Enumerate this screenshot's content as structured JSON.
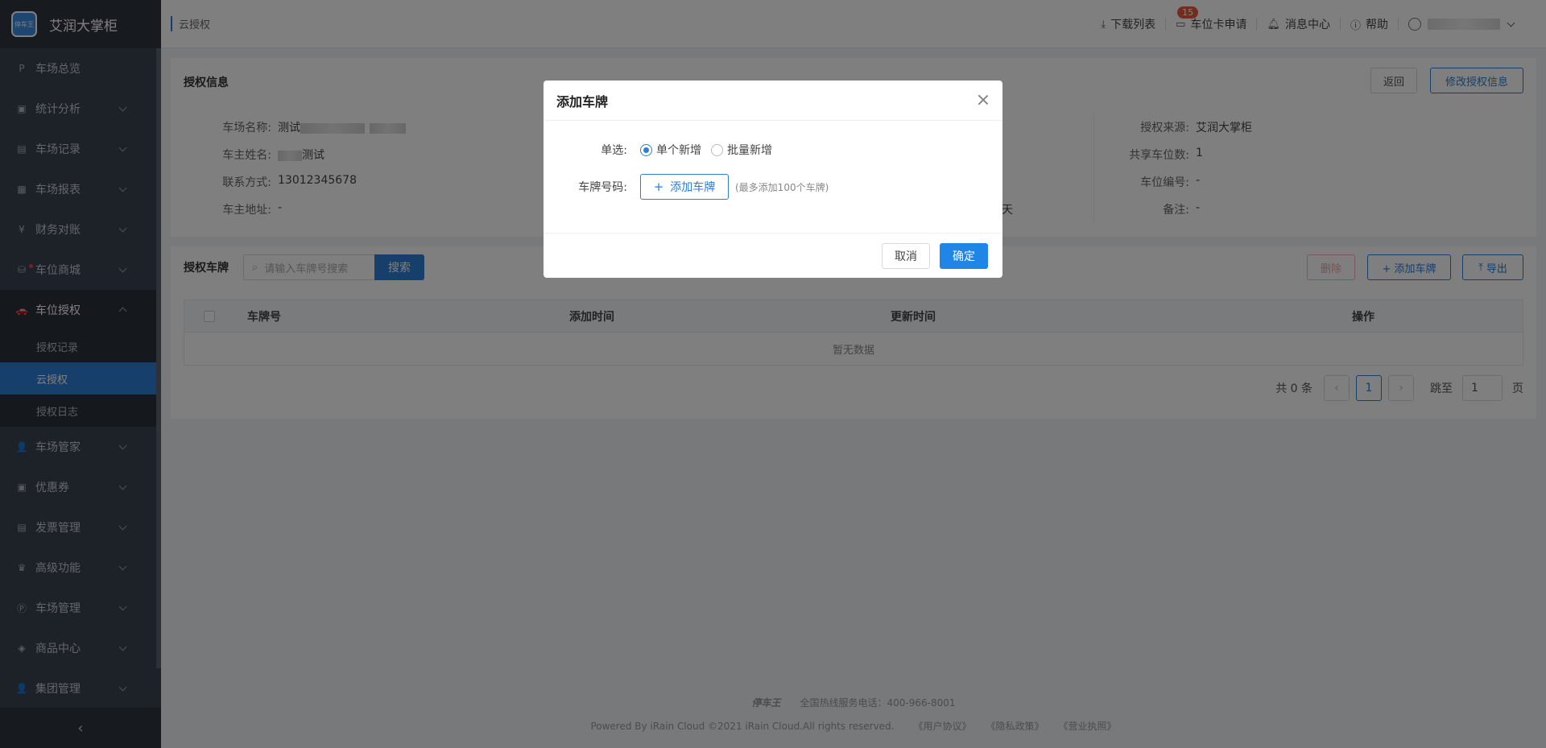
{
  "app": {
    "logo_text": "停车王",
    "name": "艾润大掌柜"
  },
  "sidebar": {
    "items": [
      {
        "label": "车场总览",
        "icon": "P"
      },
      {
        "label": "统计分析",
        "icon": "▣"
      },
      {
        "label": "车场记录",
        "icon": "▤"
      },
      {
        "label": "车场报表",
        "icon": "▦"
      },
      {
        "label": "财务对账",
        "icon": "¥"
      },
      {
        "label": "车位商城",
        "icon": "⛁"
      },
      {
        "label": "车位授权",
        "icon": "🚗"
      }
    ],
    "sub_items": [
      "授权记录",
      "云授权",
      "授权日志"
    ],
    "items_after": [
      {
        "label": "车场管家",
        "icon": "👤"
      },
      {
        "label": "优惠券",
        "icon": "▣"
      },
      {
        "label": "发票管理",
        "icon": "▤"
      },
      {
        "label": "高级功能",
        "icon": "♛"
      },
      {
        "label": "车场管理",
        "icon": "Ⓟ"
      },
      {
        "label": "商品中心",
        "icon": "◈"
      },
      {
        "label": "集团管理",
        "icon": "👤"
      }
    ],
    "collapse": "‹"
  },
  "header": {
    "breadcrumb": "云授权",
    "download": "下载列表",
    "card_apply": "车位卡申请",
    "badge": "15",
    "messages": "消息中心",
    "help": "帮助"
  },
  "info": {
    "title": "授权信息",
    "back": "返回",
    "edit": "修改授权信息",
    "rows": [
      {
        "label": "车场名称:",
        "value": "测试"
      },
      {
        "label": "车主姓名:",
        "value": "测试"
      },
      {
        "label": "联系方式:",
        "value": "13012345678"
      },
      {
        "label": "车主地址:",
        "value": "-"
      }
    ],
    "right_rows": [
      {
        "label": "授权来源:",
        "value": "艾润大掌柜"
      },
      {
        "label": "共享车位数:",
        "value": "1"
      },
      {
        "label": "车位编号:",
        "value": "-"
      },
      {
        "label": "备注:",
        "value": "-"
      }
    ],
    "partial_text": "天"
  },
  "list": {
    "title": "授权车牌",
    "search_placeholder": "请输入车牌号搜索",
    "search_btn": "搜索",
    "delete": "删除",
    "add": "+ 添加车牌",
    "export": "导出",
    "columns": [
      "车牌号",
      "添加时间",
      "更新时间",
      "操作"
    ],
    "empty": "暂无数据",
    "total": "共 0 条",
    "page": "1",
    "goto_label": "跳至",
    "goto_value": "1",
    "page_unit": "页"
  },
  "footer": {
    "logo": "停车王",
    "hotline": "全国热线服务电话：400-966-8001",
    "copyright": "Powered By iRain Cloud ©2021 iRain Cloud.All rights reserved.",
    "links": [
      "《用户协议》",
      "《隐私政策》",
      "《营业执照》"
    ]
  },
  "modal": {
    "title": "添加车牌",
    "mode_label": "单选:",
    "mode_single": "单个新增",
    "mode_batch": "批量新增",
    "plate_label": "车牌号码:",
    "add_plate": "添加车牌",
    "hint": "(最多添加100个车牌)",
    "cancel": "取消",
    "ok": "确定"
  },
  "colors": {
    "primary": "#2c7ed6",
    "sidebar": "#3b4350",
    "badge": "#e55a3c"
  }
}
